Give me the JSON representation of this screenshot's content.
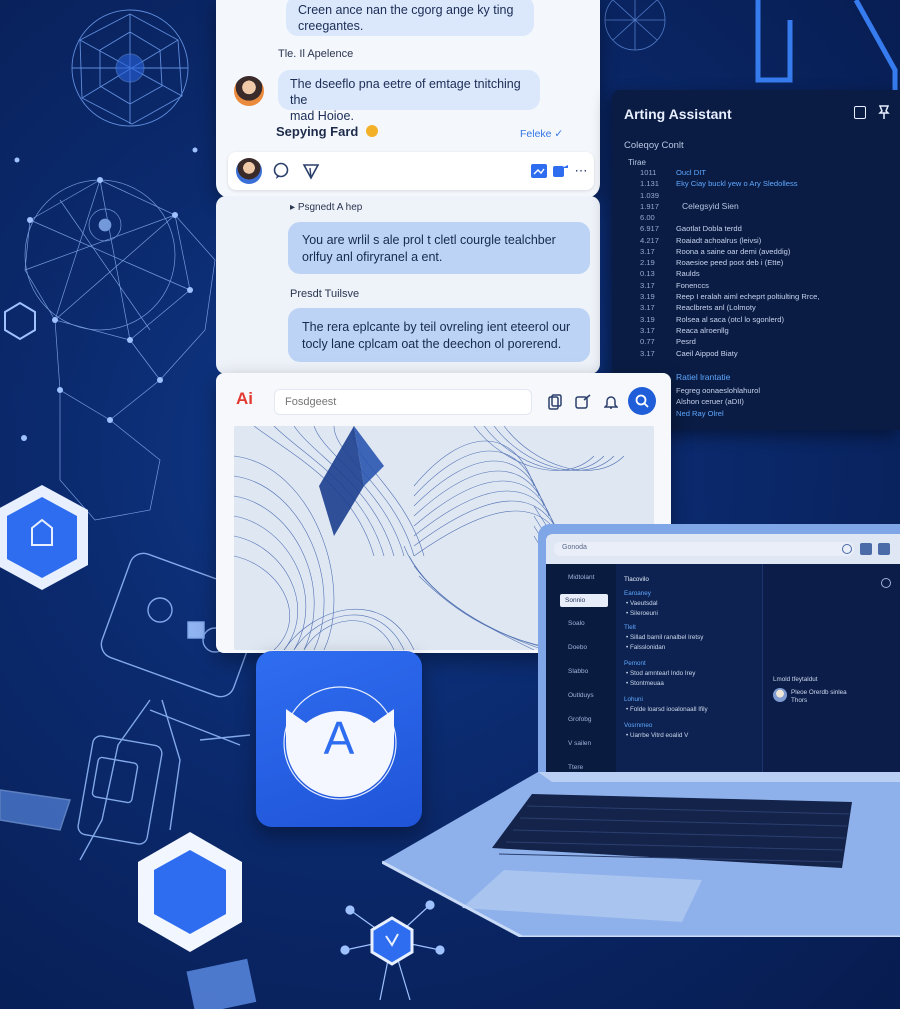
{
  "chat_top": {
    "bubble_1": "Creen ance nan the cgorg ange ky ting\ncreegantes.",
    "label_1": "Tle. Il Apelence",
    "bubble_2": "The dseeflo pna eetre of emtage tnitching the\nmad Hoioe.",
    "sender_name": "Sepying Fard",
    "reply_label": "Feleke",
    "composer_icons": [
      "avatar",
      "chat-bubble-icon",
      "send-icon",
      "image-icon",
      "share-icon",
      "more-icon"
    ]
  },
  "chat_lower": {
    "reply_label": "Psgnedt A hep",
    "bubble_1": "You are wrlil s ale prol t cletl courgle tealchber\norlfuy anl ofiryranel a ent.",
    "label_2": "Presdt Tuilsve",
    "bubble_2": "The rera eplcante by teil ovreling ient eteerol our\ntocly lane cplcam oat the deechon ol porerend."
  },
  "assistant": {
    "title": "Arting Assistant",
    "section_1": "Coleqoy Conlt",
    "col_head": "Tirae",
    "section_2": "Celegsyid Sien",
    "rows_top": [
      {
        "num": "1011",
        "text": "Oucl DIT",
        "highlight": true
      },
      {
        "num": "1.131",
        "text": "Eky Ciay buckl yew o Ary Sledolless",
        "highlight": true
      },
      {
        "num": "1.039",
        "text": ""
      },
      {
        "num": "1.917",
        "text": ""
      }
    ],
    "rows": [
      {
        "num": "6.00",
        "text": ""
      },
      {
        "num": "6.917",
        "text": "Gaotlat Dobla terdd"
      },
      {
        "num": "4.217",
        "text": "Roaiadt achoalrus (leivsi)"
      },
      {
        "num": "3.17",
        "text": "Roona a saine oar demi (aveddig)"
      },
      {
        "num": "2.19",
        "text": "Roaesioe peed poot deb i (Ette)"
      },
      {
        "num": "0.13",
        "text": "Raulds"
      },
      {
        "num": "3.17",
        "text": "Fonenccs"
      },
      {
        "num": "3.19",
        "text": "Reep I eralah aiml echeprt poltiulting Rrce,"
      },
      {
        "num": "3.17",
        "text": "Reaclbrets anl (Lolmoty"
      },
      {
        "num": "3.19",
        "text": "Rolsea al saca (otcl lo sgonlerd)"
      },
      {
        "num": "3.17",
        "text": "Reaca alroenllg"
      },
      {
        "num": "0.77",
        "text": "Pesrd"
      },
      {
        "num": "3.17",
        "text": "Caeil Aippod Biaty"
      }
    ],
    "section_3": "Ratiel lrantatie",
    "rows_bottom": [
      {
        "text": "Fegreg oonaeslohlahurol"
      },
      {
        "text": "Alshon ceruer (aDII)"
      },
      {
        "text": "Ned Ray Olrel"
      }
    ],
    "header_icons": [
      "panel-icon",
      "pin-icon"
    ]
  },
  "ai_window": {
    "logo": "Ai",
    "search_placeholder": "Fosdgeest",
    "toolbar_icons": [
      "copy-icon",
      "edit-icon",
      "bell-icon",
      "search-icon"
    ]
  },
  "app_icon": {
    "letter": "A"
  },
  "laptop": {
    "url": "Gonoda",
    "sidebar_header": "Midtolant",
    "sidebar_items": [
      "Sonnio",
      "Soalo",
      "Doebo",
      "Slabbo",
      "Outlduys",
      "Grofobg",
      "V sailen",
      "Ttere"
    ],
    "content_header": "Tlacovilo",
    "content_lines": [
      {
        "text": "Earoaney",
        "hl": true
      },
      {
        "text": "• Vaeutsdal",
        "hl": false
      },
      {
        "text": "• Sileroeuni",
        "hl": false
      },
      {
        "text": "Tlelt",
        "hl": true
      },
      {
        "text": "• Sillad bamil ranalbel Iretsy",
        "hl": false
      },
      {
        "text": "• Falsslonidan",
        "hl": false
      },
      {
        "text": "Pemont",
        "hl": true
      },
      {
        "text": "• Stod amntearl Indo Irey",
        "hl": false
      },
      {
        "text": "• Stontmeuaa",
        "hl": false
      },
      {
        "text": "Lohuni",
        "hl": true
      },
      {
        "text": "• Folde loarsd iooalonaall Ifily",
        "hl": false
      },
      {
        "text": "Vosrnmeo",
        "hl": true
      },
      {
        "text": "• Uarrbe Vitrd eoalid V",
        "hl": false
      }
    ],
    "right_panel_title": "Lmold tfeytaldut",
    "right_panel_user": "Pleoe Orerdb sinlea\nThors"
  }
}
